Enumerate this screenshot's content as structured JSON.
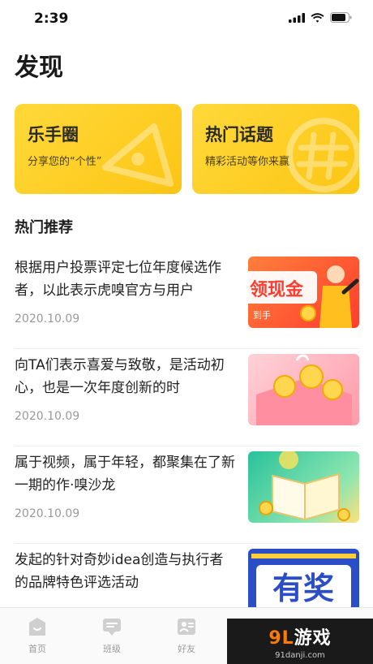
{
  "status_bar": {
    "time": "2:39"
  },
  "page": {
    "title": "发现"
  },
  "cards": [
    {
      "title": "乐手圈",
      "subtitle": "分享您的“个性”"
    },
    {
      "title": "热门话题",
      "subtitle": "精彩活动等你来赢"
    }
  ],
  "section": {
    "title": "热门推荐"
  },
  "feed": [
    {
      "title": "根据用户投票评定七位年度候选作者，以此表示虎嗅官方与用户",
      "date": "2020.10.09",
      "thumb_text": "领现金",
      "thumb_sub": "到手"
    },
    {
      "title": "向TA们表示喜爱与致敬，是活动初心，也是一次年度创新的时",
      "date": "2020.10.09"
    },
    {
      "title": "属于视频，属于年轻，都聚集在了新一期的作·嗅沙龙",
      "date": "2020.10.09"
    },
    {
      "title": "发起的针对奇妙idea创造与执行者的品牌特色评选活动",
      "thumb_text": "有奖"
    }
  ],
  "tabs": [
    {
      "label": "首页",
      "icon": "home-icon"
    },
    {
      "label": "班级",
      "icon": "class-icon"
    },
    {
      "label": "好友",
      "icon": "friends-icon"
    }
  ],
  "watermark": {
    "main_prefix": "9L",
    "main_suffix": "游戏",
    "url": "91danji.com"
  },
  "colors": {
    "card_yellow": "#fcc514",
    "tab_gray": "#999999"
  }
}
